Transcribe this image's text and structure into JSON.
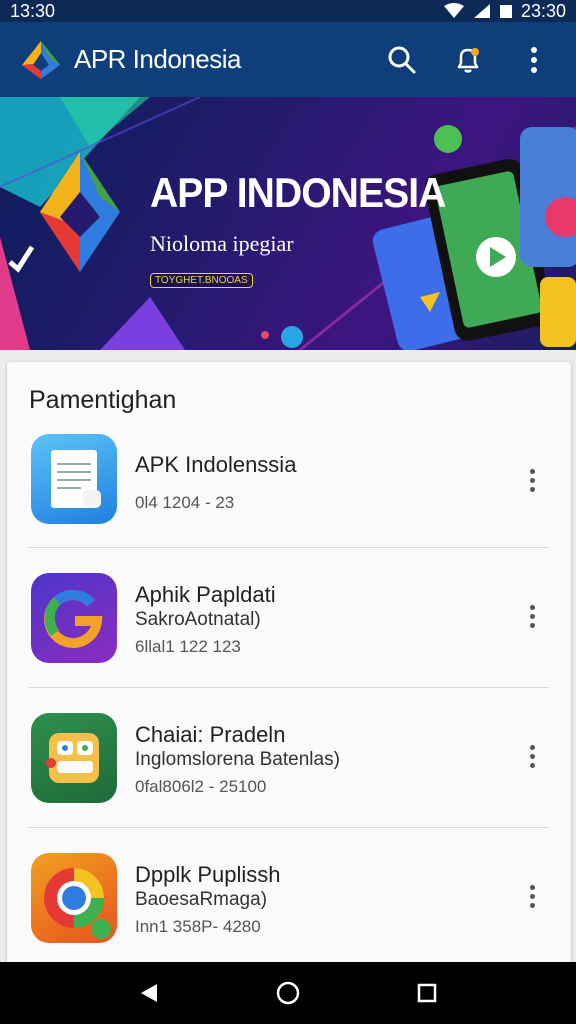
{
  "status": {
    "time_left": "13:30",
    "time_right": "23:30"
  },
  "appbar": {
    "title": "APR Indonesia"
  },
  "banner": {
    "title": "APP INDONESIA",
    "subtitle": "Nioloma ipegiar",
    "badge": "TOYGHET.BNOOAS"
  },
  "section": {
    "title": "Pamentighan"
  },
  "items": [
    {
      "name": "APK Indolenssia",
      "sub": "",
      "meta": "0l4 1204 - 23"
    },
    {
      "name": "Aphik Papldati",
      "sub": "SakroAotnatal)",
      "meta": "6llal1 122 123"
    },
    {
      "name": "Chaiai: Pradeln",
      "sub": "Inglomslorena Batenlas)",
      "meta": "0fal806l2 - 25100"
    },
    {
      "name": "Dpplk Puplissh",
      "sub": "BaoesaRmaga)",
      "meta": "Inn1 358P- 4280"
    }
  ],
  "icons": {
    "search": "search-icon",
    "notify": "notification-bell-icon",
    "more": "more-vert-icon",
    "back": "back-icon",
    "home": "home-icon",
    "recents": "recents-icon"
  }
}
